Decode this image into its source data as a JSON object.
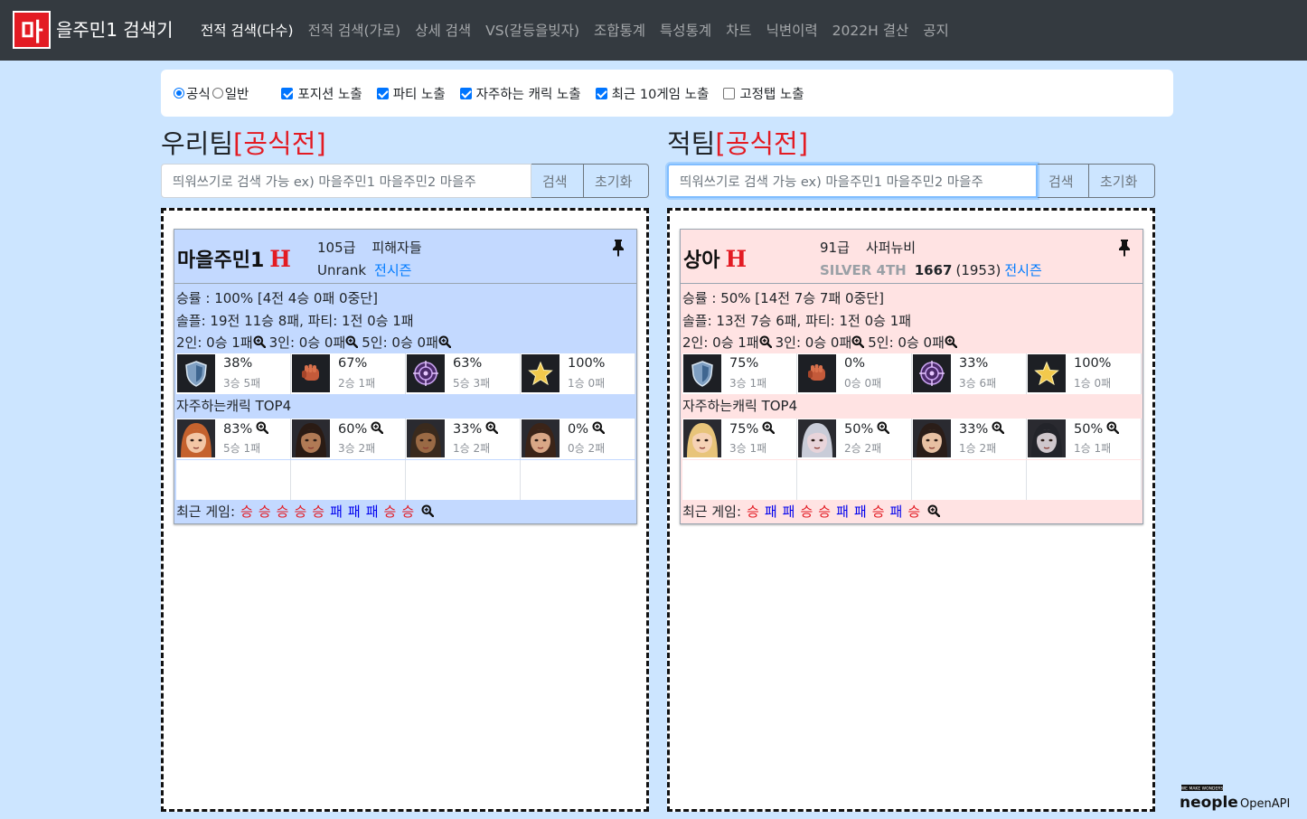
{
  "nav": {
    "logo": "마",
    "brand": "을주민1 검색기",
    "items": [
      {
        "label": "전적 검색(다수)",
        "active": true
      },
      {
        "label": "전적 검색(가로)",
        "active": false
      },
      {
        "label": "상세 검색",
        "active": false
      },
      {
        "label": "VS(갈등을빚자)",
        "active": false
      },
      {
        "label": "조합통계",
        "active": false
      },
      {
        "label": "특성통계",
        "active": false
      },
      {
        "label": "차트",
        "active": false
      },
      {
        "label": "닉변이력",
        "active": false
      },
      {
        "label": "2022H 결산",
        "active": false
      },
      {
        "label": "공지",
        "active": false
      }
    ]
  },
  "options": {
    "mode_official": "공식",
    "mode_normal": "일반",
    "checks": [
      {
        "label": "포지션 노출",
        "checked": true
      },
      {
        "label": "파티 노출",
        "checked": true
      },
      {
        "label": "자주하는 캐릭 노출",
        "checked": true
      },
      {
        "label": "최근 10게임 노출",
        "checked": true
      },
      {
        "label": "고정탭 노출",
        "checked": false
      }
    ]
  },
  "search": {
    "placeholder": "띄워쓰기로 검색 가능 ex) 마을주민1 마을주민2 마을주",
    "search_label": "검색",
    "reset_label": "초기화"
  },
  "ours": {
    "title": "우리팀",
    "tag": "[공식전]",
    "player": {
      "name": "마을주민1",
      "h": "H",
      "grade": "105급",
      "guild": "피해자들",
      "rank": "Unrank",
      "season_link": "전시즌",
      "winrate": "승률 : 100% [4전 4승 0패 0중단]",
      "solo_party": "솔플: 19전 11승 8패, 파티: 1전 0승 1패",
      "party_2": "2인: 0승 1패",
      "party_3": "3인: 0승 0패",
      "party_5": "5인: 0승 0패",
      "positions": [
        {
          "icon": "tank-shield-icon",
          "pct": "38%",
          "wl": "3승 5패"
        },
        {
          "icon": "dealer-fist-icon",
          "pct": "67%",
          "wl": "2승 1패"
        },
        {
          "icon": "ranged-target-icon",
          "pct": "63%",
          "wl": "5승 3패"
        },
        {
          "icon": "support-star-icon",
          "pct": "100%",
          "wl": "1승 0패"
        }
      ],
      "top_title": "자주하는캐릭 TOP4",
      "chars": [
        {
          "pct": "83%",
          "wl": "5승 1패",
          "skin": "#f3c6a5",
          "hair": "#c5622e"
        },
        {
          "pct": "60%",
          "wl": "3승 2패",
          "skin": "#b07a55",
          "hair": "#2a1b14"
        },
        {
          "pct": "33%",
          "wl": "1승 2패",
          "skin": "#9a6a45",
          "hair": "#3a2a1d"
        },
        {
          "pct": "0%",
          "wl": "0승 2패",
          "skin": "#d9a786",
          "hair": "#3b2418"
        }
      ],
      "recent_label": "최근 게임:",
      "recent": [
        "승",
        "승",
        "승",
        "승",
        "승",
        "패",
        "패",
        "패",
        "승",
        "승"
      ]
    }
  },
  "enemy": {
    "title": "적팀",
    "tag": "[공식전]",
    "player": {
      "name": "상아",
      "h": "H",
      "grade": "91급",
      "guild": "사퍼뉴비",
      "tier": "SILVER 4TH",
      "rating": "1667",
      "rating_paren": "(1953)",
      "season_link": "전시즌",
      "winrate": "승률 : 50% [14전 7승 7패 0중단]",
      "solo_party": "솔플: 13전 7승 6패, 파티: 1전 0승 1패",
      "party_2": "2인: 0승 1패",
      "party_3": "3인: 0승 0패",
      "party_5": "5인: 0승 0패",
      "positions": [
        {
          "icon": "tank-shield-icon",
          "pct": "75%",
          "wl": "3승 1패"
        },
        {
          "icon": "dealer-fist-icon",
          "pct": "0%",
          "wl": "0승 0패"
        },
        {
          "icon": "ranged-target-icon",
          "pct": "33%",
          "wl": "3승 6패"
        },
        {
          "icon": "support-star-icon",
          "pct": "100%",
          "wl": "1승 0패"
        }
      ],
      "top_title": "자주하는캐릭 TOP4",
      "chars": [
        {
          "pct": "75%",
          "wl": "3승 1패",
          "skin": "#f6d2b5",
          "hair": "#e8c47a"
        },
        {
          "pct": "50%",
          "wl": "2승 2패",
          "skin": "#e8d4da",
          "hair": "#c9ccd8"
        },
        {
          "pct": "33%",
          "wl": "1승 2패",
          "skin": "#e7c0a2",
          "hair": "#2a1d18"
        },
        {
          "pct": "50%",
          "wl": "1승 1패",
          "skin": "#cfc7cc",
          "hair": "#23242a"
        }
      ],
      "recent_label": "최근 게임:",
      "recent": [
        "승",
        "패",
        "패",
        "승",
        "승",
        "패",
        "패",
        "승",
        "패",
        "승"
      ]
    }
  },
  "footer": {
    "brand": "neople",
    "api": "OpenAPI",
    "tagline": "WE MAKE WONDERS"
  }
}
